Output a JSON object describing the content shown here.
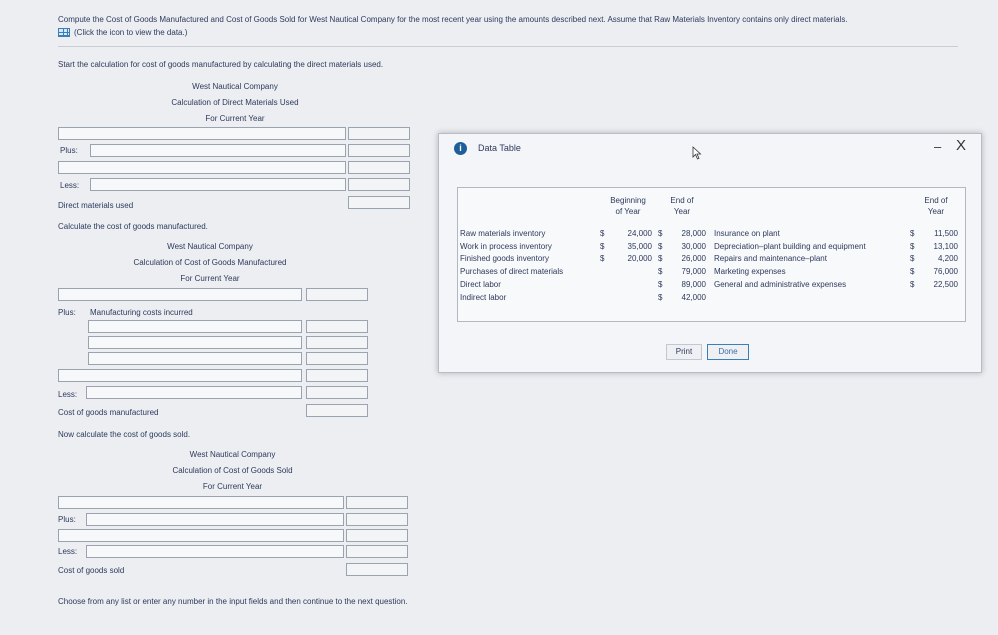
{
  "intro": "Compute the Cost of Goods Manufactured and Cost of Goods Sold for West Nautical Company for the most recent year using the amounts described next. Assume that Raw Materials Inventory contains only direct materials.",
  "data_link": "(Click the icon to view the data.)",
  "start_text": "Start the calculation for cost of goods manufactured by calculating the direct materials used.",
  "dm_schedule": {
    "company": "West Nautical Company",
    "title": "Calculation of Direct Materials Used",
    "period": "For Current Year",
    "plus": "Plus:",
    "less": "Less:",
    "total": "Direct materials used"
  },
  "cogm_prompt": "Calculate the cost of goods manufactured.",
  "cogm_schedule": {
    "company": "West Nautical Company",
    "title": "Calculation of Cost of Goods Manufactured",
    "period": "For Current Year",
    "plus": "Plus:",
    "mfg": "Manufacturing costs incurred",
    "less": "Less:",
    "total": "Cost of goods manufactured"
  },
  "cogs_prompt": "Now calculate the cost of goods sold.",
  "cogs_schedule": {
    "company": "West Nautical Company",
    "title": "Calculation of Cost of Goods Sold",
    "period": "For Current Year",
    "plus": "Plus:",
    "less": "Less:",
    "total": "Cost of goods sold"
  },
  "footer": "Choose from any list or enter any number in the input fields and then continue to the next question.",
  "modal": {
    "title": "Data Table",
    "min": "–",
    "close": "X",
    "headers": {
      "beginning": [
        "Beginning",
        "of Year"
      ],
      "end_left": [
        "End of",
        "Year"
      ],
      "end_right": [
        "End of",
        "Year"
      ]
    },
    "left_rows": [
      {
        "label": "Raw materials inventory",
        "b_sign": "$",
        "b_val": "24,000",
        "e_sign": "$",
        "e_val": "28,000"
      },
      {
        "label": "Work in process inventory",
        "b_sign": "$",
        "b_val": "35,000",
        "e_sign": "$",
        "e_val": "30,000"
      },
      {
        "label": "Finished goods inventory",
        "b_sign": "$",
        "b_val": "20,000",
        "e_sign": "$",
        "e_val": "26,000"
      },
      {
        "label": "Purchases of direct materials",
        "b_sign": "",
        "b_val": "",
        "e_sign": "$",
        "e_val": "79,000"
      },
      {
        "label": "Direct labor",
        "b_sign": "",
        "b_val": "",
        "e_sign": "$",
        "e_val": "89,000"
      },
      {
        "label": "Indirect labor",
        "b_sign": "",
        "b_val": "",
        "e_sign": "$",
        "e_val": "42,000"
      }
    ],
    "right_rows": [
      {
        "label": "Insurance on plant",
        "sign": "$",
        "val": "11,500"
      },
      {
        "label": "Depreciation–plant building and equipment",
        "sign": "$",
        "val": "13,100"
      },
      {
        "label": "Repairs and maintenance–plant",
        "sign": "$",
        "val": "4,200"
      },
      {
        "label": "Marketing expenses",
        "sign": "$",
        "val": "76,000"
      },
      {
        "label": "General and administrative expenses",
        "sign": "$",
        "val": "22,500"
      }
    ],
    "print": "Print",
    "done": "Done"
  }
}
